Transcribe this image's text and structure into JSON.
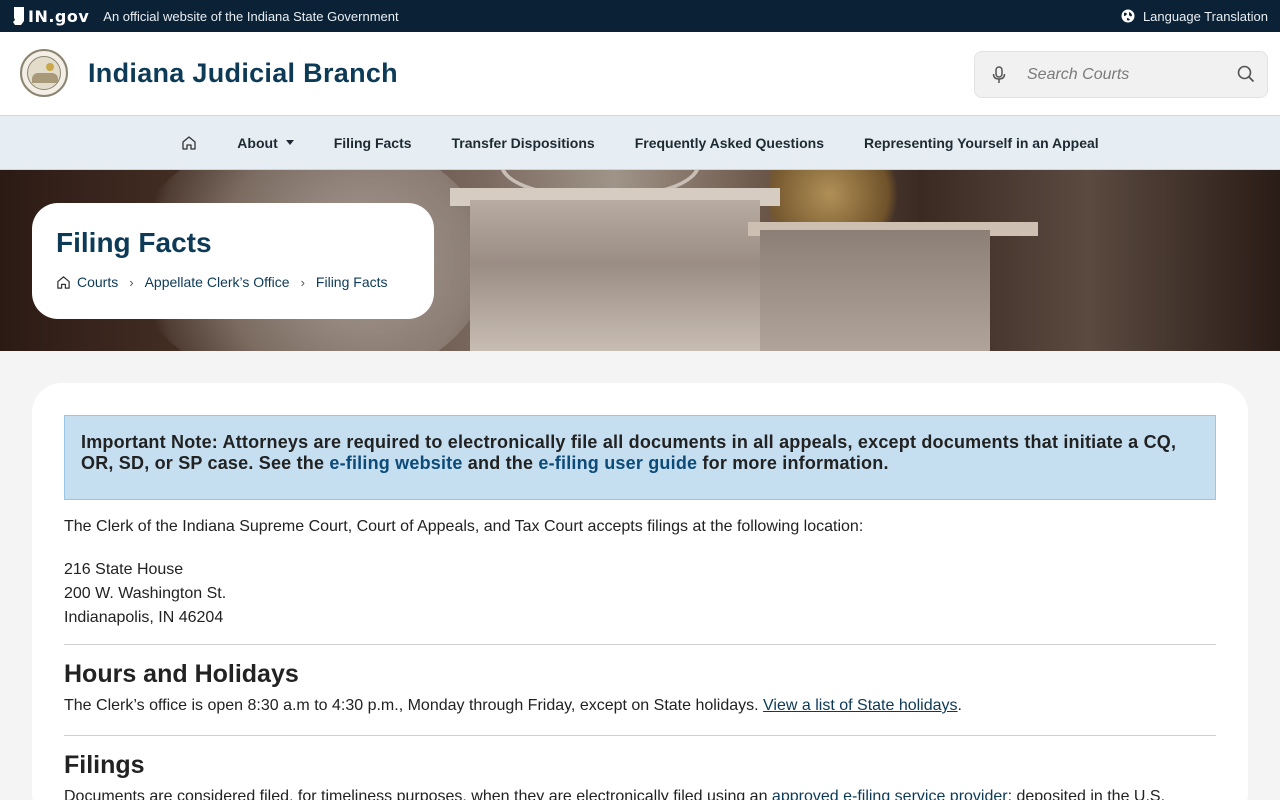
{
  "govbar": {
    "logo_text": "IN.gov",
    "official_text": "An official website of the Indiana State Government",
    "language_label": "Language Translation"
  },
  "header": {
    "site_title": "Indiana Judicial Branch",
    "search_placeholder": "Search Courts"
  },
  "nav": {
    "items": [
      {
        "label": "About"
      },
      {
        "label": "Filing Facts"
      },
      {
        "label": "Transfer Dispositions"
      },
      {
        "label": "Frequently Asked Questions"
      },
      {
        "label": "Representing Yourself in an Appeal"
      }
    ]
  },
  "page": {
    "title": "Filing Facts",
    "breadcrumbs": [
      "Courts",
      "Appellate Clerk’s Office",
      "Filing Facts"
    ]
  },
  "note": {
    "prefix": "Important Note: Attorneys are required to electronically file all documents in all appeals, except documents that initiate a CQ, OR, SD, or SP case. See the ",
    "link1": "e-filing website",
    "middle": " and the ",
    "link2": "e-filing user guide",
    "suffix": " for more information."
  },
  "intro": "The Clerk of the Indiana Supreme Court, Court of Appeals, and Tax Court accepts filings at the following location:",
  "address": {
    "line1": "216 State House",
    "line2": "200 W. Washington St.",
    "line3": "Indianapolis, IN 46204"
  },
  "hours": {
    "heading": "Hours and Holidays",
    "text": "The Clerk’s office is open 8:30 a.m to 4:30 p.m., Monday through Friday, except on State holidays. ",
    "link": "View a list of State holidays",
    "suffix": "."
  },
  "filings": {
    "heading": "Filings",
    "text": "Documents are considered filed, for timeliness purposes, when they are electronically filed using an ",
    "link": "approved e-filing service provider",
    "suffix": "; deposited in the U.S."
  },
  "colors": {
    "govbar_bg": "#0b2236",
    "brand_navy": "#0c3a57",
    "nav_bg": "#e6eef3",
    "note_bg": "#c5dff0"
  }
}
